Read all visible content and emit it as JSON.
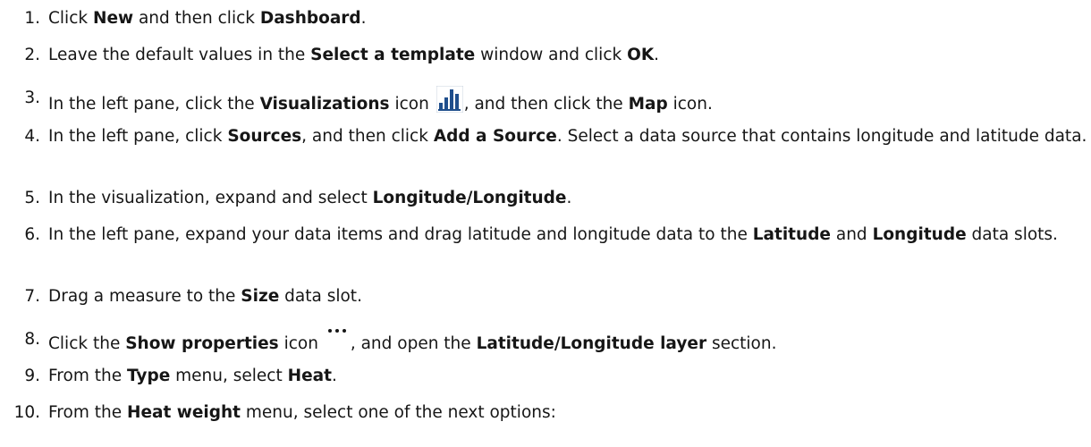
{
  "steps": [
    {
      "num": "1.",
      "parts": [
        "Click ",
        "New",
        " and then click ",
        "Dashboard",
        "."
      ]
    },
    {
      "num": "2.",
      "parts": [
        "Leave the default values in the ",
        "Select a template",
        " window and click ",
        "OK",
        "."
      ]
    },
    {
      "num": "3.",
      "parts": [
        "In the left pane, click the ",
        "Visualizations",
        " icon ",
        ", and then click the ",
        "Map",
        " icon."
      ],
      "icon": "visualizations-icon"
    },
    {
      "num": "4.",
      "parts": [
        "In the left pane, click ",
        "Sources",
        ", and then click ",
        "Add a Source",
        ". Select a data source that contains longitude and latitude data."
      ]
    },
    {
      "num": "5.",
      "parts": [
        "In the visualization, expand and select ",
        "Longitude/Longitude",
        "."
      ]
    },
    {
      "num": "6.",
      "parts": [
        "In the left pane, expand your data items and drag latitude and longitude data to the ",
        "Latitude",
        " and ",
        "Longitude",
        " data slots."
      ]
    },
    {
      "num": "7.",
      "parts": [
        "Drag a measure to the ",
        "Size",
        " data slot."
      ]
    },
    {
      "num": "8.",
      "parts": [
        "Click the ",
        "Show properties",
        " icon ",
        ", and open the ",
        "Latitude/Longitude layer",
        " section."
      ],
      "icon": "more-options-icon"
    },
    {
      "num": "9.",
      "parts": [
        "From the ",
        "Type",
        " menu, select ",
        "Heat",
        "."
      ]
    },
    {
      "num": "10.",
      "parts": [
        "From the ",
        "Heat weight",
        " menu, select one of the next options:"
      ]
    }
  ],
  "colors": {
    "text": "#161616",
    "icon_blue": "#1f4e8c"
  }
}
